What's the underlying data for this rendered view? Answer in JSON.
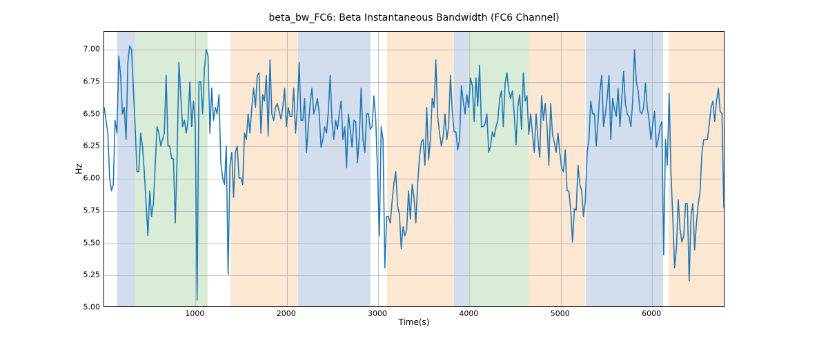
{
  "chart_data": {
    "type": "line",
    "title": "beta_bw_FC6: Beta Instantaneous Bandwidth (FC6 Channel)",
    "xlabel": "Time(s)",
    "ylabel": "Hz",
    "xlim": [
      0,
      6800
    ],
    "ylim": [
      5.0,
      7.14
    ],
    "xticks": [
      1000,
      2000,
      3000,
      4000,
      5000,
      6000
    ],
    "yticks": [
      5.0,
      5.25,
      5.5,
      5.75,
      6.0,
      6.25,
      6.5,
      6.75,
      7.0
    ],
    "bands": [
      {
        "start": 140,
        "end": 340,
        "color": "blue"
      },
      {
        "start": 340,
        "end": 1130,
        "color": "green"
      },
      {
        "start": 1380,
        "end": 2120,
        "color": "orange"
      },
      {
        "start": 2120,
        "end": 2920,
        "color": "blue"
      },
      {
        "start": 3100,
        "end": 3830,
        "color": "orange"
      },
      {
        "start": 3830,
        "end": 3980,
        "color": "blue"
      },
      {
        "start": 3980,
        "end": 4650,
        "color": "green"
      },
      {
        "start": 4650,
        "end": 5270,
        "color": "orange"
      },
      {
        "start": 5270,
        "end": 6120,
        "color": "blue"
      },
      {
        "start": 6180,
        "end": 6800,
        "color": "orange"
      }
    ],
    "series": [
      {
        "name": "beta_bw_FC6",
        "x": [
          0,
          20,
          40,
          60,
          80,
          100,
          120,
          140,
          160,
          180,
          200,
          220,
          240,
          260,
          280,
          300,
          320,
          340,
          360,
          380,
          400,
          420,
          440,
          460,
          480,
          500,
          520,
          540,
          560,
          580,
          600,
          620,
          640,
          660,
          680,
          700,
          720,
          740,
          760,
          780,
          800,
          820,
          840,
          860,
          880,
          900,
          920,
          940,
          960,
          980,
          1000,
          1020,
          1040,
          1060,
          1080,
          1100,
          1120,
          1140,
          1160,
          1180,
          1200,
          1220,
          1240,
          1260,
          1280,
          1300,
          1320,
          1340,
          1360,
          1380,
          1400,
          1420,
          1440,
          1460,
          1480,
          1500,
          1520,
          1540,
          1560,
          1580,
          1600,
          1620,
          1640,
          1660,
          1680,
          1700,
          1720,
          1740,
          1760,
          1780,
          1800,
          1820,
          1840,
          1860,
          1880,
          1900,
          1920,
          1940,
          1960,
          1980,
          2000,
          2020,
          2040,
          2060,
          2080,
          2100,
          2120,
          2140,
          2160,
          2180,
          2200,
          2220,
          2240,
          2260,
          2280,
          2300,
          2320,
          2340,
          2360,
          2380,
          2400,
          2420,
          2440,
          2460,
          2480,
          2500,
          2520,
          2540,
          2560,
          2580,
          2600,
          2620,
          2640,
          2660,
          2680,
          2700,
          2720,
          2740,
          2760,
          2780,
          2800,
          2820,
          2840,
          2860,
          2880,
          2900,
          2920,
          2940,
          2960,
          2980,
          3000,
          3020,
          3040,
          3060,
          3080,
          3100,
          3120,
          3140,
          3160,
          3180,
          3200,
          3220,
          3240,
          3260,
          3280,
          3300,
          3320,
          3340,
          3360,
          3380,
          3400,
          3420,
          3440,
          3460,
          3480,
          3500,
          3520,
          3540,
          3560,
          3580,
          3600,
          3620,
          3640,
          3660,
          3680,
          3700,
          3720,
          3740,
          3760,
          3780,
          3800,
          3820,
          3840,
          3860,
          3880,
          3900,
          3920,
          3940,
          3960,
          3980,
          4000,
          4020,
          4040,
          4060,
          4080,
          4100,
          4120,
          4140,
          4160,
          4180,
          4200,
          4220,
          4240,
          4260,
          4280,
          4300,
          4320,
          4340,
          4360,
          4380,
          4400,
          4420,
          4440,
          4460,
          4480,
          4500,
          4520,
          4540,
          4560,
          4580,
          4600,
          4620,
          4640,
          4660,
          4680,
          4700,
          4720,
          4740,
          4760,
          4780,
          4800,
          4820,
          4840,
          4860,
          4880,
          4900,
          4920,
          4940,
          4960,
          4980,
          5000,
          5020,
          5040,
          5060,
          5080,
          5100,
          5120,
          5140,
          5160,
          5180,
          5200,
          5220,
          5240,
          5260,
          5280,
          5300,
          5320,
          5340,
          5360,
          5380,
          5400,
          5420,
          5440,
          5460,
          5480,
          5500,
          5520,
          5540,
          5560,
          5580,
          5600,
          5620,
          5640,
          5660,
          5680,
          5700,
          5720,
          5740,
          5760,
          5780,
          5800,
          5820,
          5840,
          5860,
          5880,
          5900,
          5920,
          5940,
          5960,
          5980,
          6000,
          6020,
          6040,
          6060,
          6080,
          6100,
          6120,
          6140,
          6160,
          6180,
          6200,
          6220,
          6240,
          6260,
          6280,
          6300,
          6320,
          6340,
          6360,
          6380,
          6400,
          6420,
          6440,
          6460,
          6480,
          6500,
          6520,
          6540,
          6560,
          6580,
          6600,
          6620,
          6640,
          6660,
          6680,
          6700,
          6720,
          6740,
          6760,
          6780,
          6800
        ],
        "y": [
          6.55,
          6.45,
          6.35,
          6.0,
          5.9,
          5.95,
          6.45,
          6.35,
          6.95,
          6.8,
          6.5,
          6.55,
          6.3,
          6.9,
          7.03,
          7.0,
          6.7,
          6.4,
          6.05,
          6.05,
          6.35,
          6.25,
          6.05,
          5.8,
          5.55,
          5.9,
          5.7,
          5.8,
          6.1,
          6.4,
          6.35,
          6.25,
          6.3,
          6.35,
          6.8,
          6.25,
          6.25,
          6.15,
          6.15,
          5.65,
          6.15,
          6.9,
          6.65,
          6.4,
          6.45,
          6.35,
          6.45,
          6.75,
          6.4,
          6.6,
          6.4,
          5.05,
          6.75,
          6.75,
          6.5,
          6.85,
          7.0,
          6.95,
          6.35,
          6.7,
          6.45,
          6.55,
          6.5,
          6.65,
          6.12,
          6.0,
          5.95,
          6.25,
          5.25,
          6.1,
          6.2,
          5.85,
          6.2,
          6.25,
          6.0,
          6.0,
          5.95,
          6.35,
          6.3,
          6.5,
          6.35,
          6.55,
          6.7,
          6.55,
          6.8,
          6.82,
          6.35,
          6.65,
          6.6,
          6.8,
          6.33,
          6.92,
          6.5,
          6.45,
          6.55,
          6.58,
          6.52,
          6.46,
          6.55,
          6.7,
          6.4,
          6.55,
          6.48,
          6.48,
          6.7,
          6.35,
          6.55,
          6.9,
          6.45,
          6.45,
          6.62,
          6.2,
          6.4,
          6.58,
          6.7,
          6.5,
          6.55,
          6.62,
          6.5,
          6.24,
          6.3,
          6.4,
          6.35,
          6.52,
          6.8,
          6.44,
          6.3,
          6.45,
          6.38,
          6.5,
          6.6,
          6.3,
          6.4,
          6.08,
          6.5,
          6.38,
          6.24,
          6.45,
          6.44,
          6.12,
          6.32,
          6.7,
          6.3,
          6.2,
          6.5,
          6.5,
          6.38,
          6.4,
          6.64,
          6.46,
          6.05,
          5.55,
          6.4,
          6.3,
          5.3,
          5.7,
          5.7,
          5.65,
          5.82,
          5.96,
          6.05,
          5.78,
          5.72,
          5.45,
          5.62,
          5.55,
          5.6,
          5.9,
          5.68,
          5.95,
          5.85,
          5.65,
          5.95,
          6.16,
          6.28,
          6.3,
          6.1,
          6.55,
          6.14,
          6.3,
          6.62,
          6.55,
          6.92,
          6.48,
          6.35,
          6.25,
          6.32,
          6.5,
          6.3,
          6.4,
          6.8,
          6.52,
          6.36,
          6.36,
          6.22,
          6.3,
          6.72,
          6.6,
          6.5,
          6.65,
          6.55,
          6.78,
          6.72,
          6.44,
          6.78,
          6.56,
          6.88,
          6.4,
          6.4,
          6.42,
          6.5,
          6.2,
          6.25,
          6.36,
          6.32,
          6.4,
          6.45,
          6.62,
          6.68,
          6.4,
          6.74,
          6.82,
          6.68,
          6.62,
          6.68,
          6.5,
          6.26,
          6.56,
          6.65,
          6.38,
          6.82,
          6.6,
          6.64,
          6.34,
          6.5,
          6.35,
          6.2,
          6.5,
          6.3,
          6.16,
          6.64,
          6.45,
          6.58,
          6.4,
          6.1,
          6.58,
          6.34,
          6.28,
          6.2,
          6.35,
          6.2,
          6.08,
          6.05,
          6.22,
          5.9,
          5.9,
          5.75,
          5.5,
          5.76,
          5.75,
          6.1,
          5.95,
          5.9,
          5.7,
          5.82,
          6.2,
          6.3,
          6.6,
          6.5,
          6.5,
          6.25,
          6.45,
          6.67,
          6.8,
          6.4,
          6.5,
          6.62,
          6.8,
          6.3,
          6.62,
          6.54,
          6.48,
          6.7,
          6.4,
          6.62,
          6.83,
          6.58,
          6.5,
          6.48,
          6.4,
          6.6,
          7.0,
          6.75,
          6.68,
          6.52,
          6.5,
          6.55,
          6.74,
          6.55,
          6.45,
          6.3,
          6.42,
          6.52,
          6.24,
          6.3,
          6.4,
          6.44,
          5.4,
          6.3,
          6.1,
          6.66,
          6.04,
          5.7,
          5.3,
          5.45,
          5.83,
          5.6,
          5.5,
          5.55,
          5.8,
          5.8,
          5.2,
          5.7,
          5.8,
          5.44,
          5.65,
          5.8,
          5.9,
          6.2,
          6.3,
          6.3,
          6.3,
          6.42,
          6.55,
          6.6,
          6.44,
          6.6,
          6.7,
          6.52,
          6.5,
          5.77
        ]
      }
    ]
  }
}
